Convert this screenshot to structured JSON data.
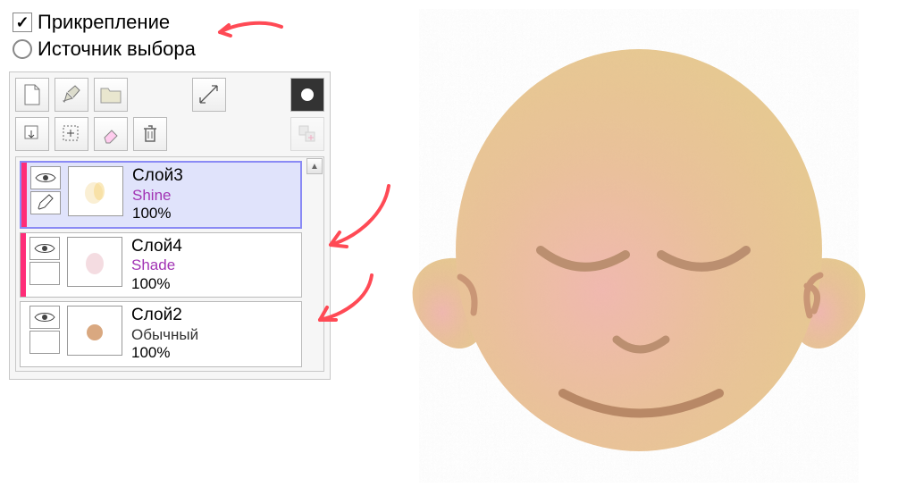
{
  "options": {
    "clipping_label": "Прикрепление",
    "clipping_checked": true,
    "selection_source_label": "Источник выбора",
    "selection_source_checked": false
  },
  "toolbar": {
    "row1": [
      "new-layer",
      "new-linework",
      "new-layerset",
      "transform",
      "mask"
    ],
    "row2": [
      "merge-down",
      "new-selection",
      "clear",
      "delete",
      "add-mask"
    ]
  },
  "layers": [
    {
      "name": "Слой3",
      "mode": "Shine",
      "mode_color": "purple",
      "opacity": "100%",
      "selected": true,
      "clipped": true,
      "editing": true
    },
    {
      "name": "Слой4",
      "mode": "Shade",
      "mode_color": "purple",
      "opacity": "100%",
      "selected": false,
      "clipped": true,
      "editing": false
    },
    {
      "name": "Слой2",
      "mode": "Обычный",
      "mode_color": "normal",
      "opacity": "100%",
      "selected": false,
      "clipped": false,
      "editing": false
    }
  ],
  "canvas": {
    "description": "cartoon bald head with closed eyes, skin-tone gradient pink to tan"
  }
}
